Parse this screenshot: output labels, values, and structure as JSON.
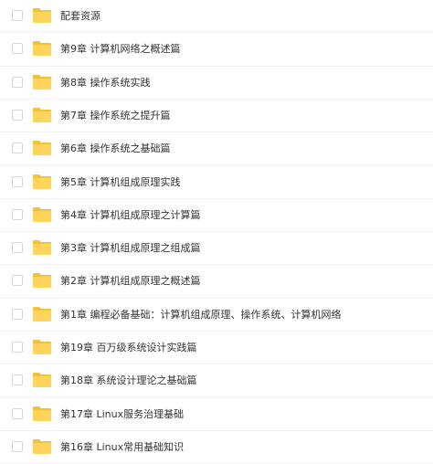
{
  "colors": {
    "folder_back": "#F5C13B",
    "folder_front": "#FFD45C",
    "text": "#333333",
    "checkbox_border": "#D6D6D6",
    "divider": "#F2F2F2"
  },
  "files": {
    "items": [
      {
        "name": "配套资源",
        "icon": "folder-icon"
      },
      {
        "name": "第9章 计算机网络之概述篇",
        "icon": "folder-icon"
      },
      {
        "name": "第8章 操作系统实践",
        "icon": "folder-icon"
      },
      {
        "name": "第7章 操作系统之提升篇",
        "icon": "folder-icon"
      },
      {
        "name": "第6章 操作系统之基础篇",
        "icon": "folder-icon"
      },
      {
        "name": "第5章 计算机组成原理实践",
        "icon": "folder-icon"
      },
      {
        "name": "第4章 计算机组成原理之计算篇",
        "icon": "folder-icon"
      },
      {
        "name": "第3章 计算机组成原理之组成篇",
        "icon": "folder-icon"
      },
      {
        "name": "第2章 计算机组成原理之概述篇",
        "icon": "folder-icon"
      },
      {
        "name": "第1章 编程必备基础：计算机组成原理、操作系统、计算机网络",
        "icon": "folder-icon"
      },
      {
        "name": "第19章 百万级系统设计实践篇",
        "icon": "folder-icon"
      },
      {
        "name": "第18章 系统设计理论之基础篇",
        "icon": "folder-icon"
      },
      {
        "name": "第17章 Linux服务治理基础",
        "icon": "folder-icon"
      },
      {
        "name": "第16章 Linux常用基础知识",
        "icon": "folder-icon"
      }
    ]
  }
}
